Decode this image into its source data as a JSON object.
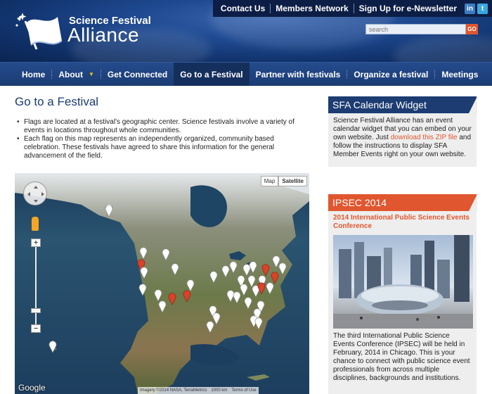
{
  "top_links": {
    "contact": "Contact Us",
    "members": "Members Network",
    "newsletter": "Sign Up for e-Newsletter"
  },
  "social": {
    "linkedin": "in",
    "twitter": "t"
  },
  "logo": {
    "line1": "Science Festival",
    "line2": "Alliance"
  },
  "search": {
    "placeholder": "search",
    "button": "GO"
  },
  "nav": {
    "home": "Home",
    "about": "About",
    "connected": "Get Connected",
    "goto": "Go to a Festival",
    "partner": "Partner with festivals",
    "organize": "Organize a festival",
    "meetings": "Meetings"
  },
  "main": {
    "title": "Go to a Festival",
    "bullet1": "Flags are located at a festival's geographic center. Science festivals involve a variety of events in locations throughout whole communities.",
    "bullet2": "Each flag on this map represents an independently organized, community based celebration. These festivals have agreed to share this information for the general advancement of the field."
  },
  "map": {
    "type_map": "Map",
    "type_satellite": "Satellite",
    "zoom_in": "+",
    "zoom_out": "−",
    "brand": "Google",
    "imagery": "Imagery ©2014 NASA, TerraMetrics",
    "scale": "1000 km",
    "terms": "Terms of Use"
  },
  "widget": {
    "title": "SFA Calendar Widget",
    "text_before": "Science Festival Alliance has an event calendar widget that you can embed on your own website. Just ",
    "link": "download this ZIP file",
    "text_after": " and follow the instructions to display SFA Member Events right on your own website."
  },
  "ipsec": {
    "title": "IPSEC 2014",
    "subtitle": "2014 International Public Science Events Conference",
    "body": "The third International Public Science Events Conference (IPSEC) will be held in February, 2014 in Chicago. This is your chance to connect with public science event professionals from across multiple disciplines, backgrounds and institutions."
  },
  "colors": {
    "brand_blue": "#1c3c72",
    "accent_orange": "#e0562f"
  }
}
